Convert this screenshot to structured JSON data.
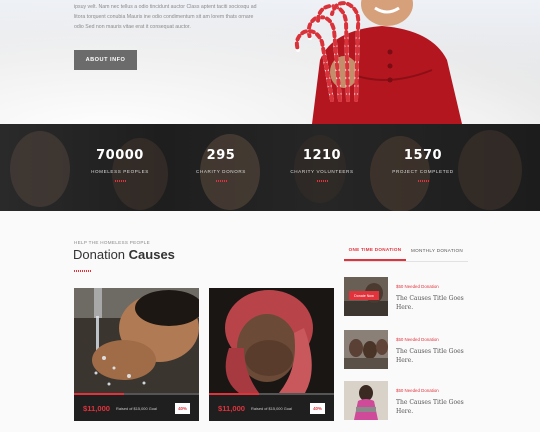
{
  "hero": {
    "text_line1": "ipsuy velt. Nam nec tellus a odio tincidunt auctor Class aptent taciti sociosqu ad",
    "text_line2": "litora torquent conubia Mauris ine odio condimentum sit am lorem thats ornare",
    "text_line3": "odio Sed non mauris vitae erat it consequat auctor.",
    "button_label": "ABOUT INFO"
  },
  "stats": [
    {
      "number": "70000",
      "label": "HOMELESS PEOPLES"
    },
    {
      "number": "295",
      "label": "CHARITY DONORS"
    },
    {
      "number": "1210",
      "label": "CHARITY VOLUNTEERS"
    },
    {
      "number": "1570",
      "label": "PROJECT COMPLETED"
    }
  ],
  "causes": {
    "kicker": "HELP THE HOMELESS PEOPLE",
    "title_light": "Donation ",
    "title_bold": "Causes",
    "cards": [
      {
        "amount": "$11,000",
        "goal": "Raised of $15,000 Goal",
        "percent": "40%",
        "progress": 0.4
      },
      {
        "amount": "$11,000",
        "goal": "Raised of $15,000 Goal",
        "percent": "40%",
        "progress": 0.4
      }
    ]
  },
  "tabs": {
    "one_time": "ONE TIME DONATION",
    "monthly": "MONTHLY DONATION"
  },
  "side_items": [
    {
      "need": "$50 Needed Donation",
      "title": "The Causes Title Goes Here.",
      "button": "Donate Now"
    },
    {
      "need": "$50 Needed Donation",
      "title": "The Causes Title Goes Here."
    },
    {
      "need": "$50 Needed Donation",
      "title": "The Causes Title Goes Here."
    }
  ],
  "colors": {
    "accent": "#e0333c",
    "stats_bg": "#1e1e1e",
    "button_gray": "#6b6b6b"
  }
}
